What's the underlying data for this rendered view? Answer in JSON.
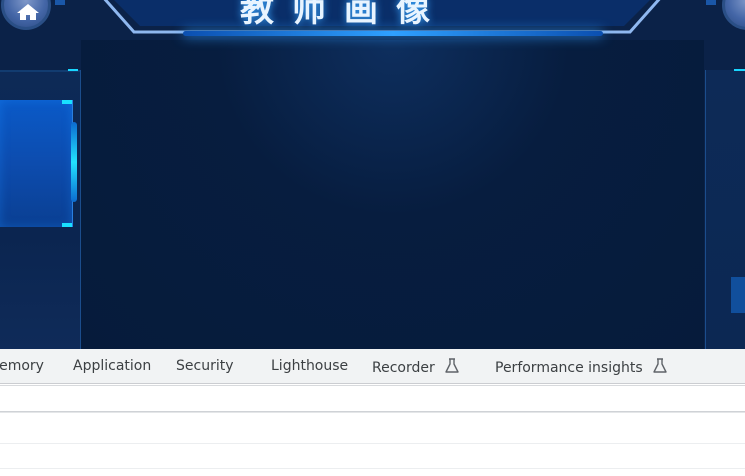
{
  "app": {
    "page_title": "教师画像",
    "home_icon": "home-icon"
  },
  "devtools": {
    "tabs": [
      {
        "label": "Memory",
        "visible_text": "lemory"
      },
      {
        "label": "Application"
      },
      {
        "label": "Security"
      },
      {
        "label": "Lighthouse"
      },
      {
        "label": "Recorder",
        "icon": "flask-icon"
      },
      {
        "label": "Performance insights",
        "icon": "flask-icon"
      }
    ]
  },
  "colors": {
    "stage_bg": "#0b2248",
    "accent": "#19d6ff",
    "glow": "#2fa0ff",
    "tabbar_bg": "#f1f3f4",
    "tab_text": "#3c4043"
  }
}
